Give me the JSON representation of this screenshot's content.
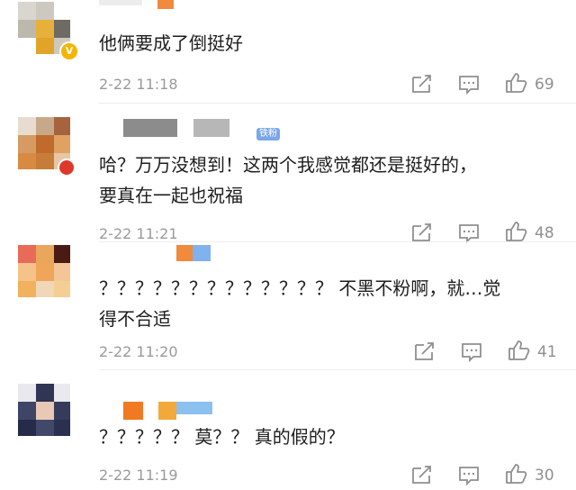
{
  "comments": [
    {
      "text_lines": [
        "他俩要成了倒挺好"
      ],
      "time": "2-22 11:18",
      "likes": "69"
    },
    {
      "text_lines": [
        "哈？万万没想到！这两个我感觉都还是挺好的，",
        "要真在一起也祝福"
      ],
      "time": "2-22 11:21",
      "likes": "48",
      "badge": "铁粉"
    },
    {
      "text_lines": [
        "？？？？？？？？？？？？？ 不黑不粉啊，就…觉",
        "得不合适"
      ],
      "time": "2-22 11:20",
      "likes": "41"
    },
    {
      "text_lines": [
        "？？？？？ 莫？？ 真的假的？"
      ],
      "time": "2-22 11:19",
      "likes": "30"
    }
  ],
  "icons": {
    "share": "share-icon",
    "comment": "comment-icon",
    "like": "thumbs-up-icon"
  },
  "colors": {
    "text": "#1e1e1e",
    "meta": "#9a9a9a",
    "icon": "#8f8f8f",
    "divider": "#ededed"
  }
}
